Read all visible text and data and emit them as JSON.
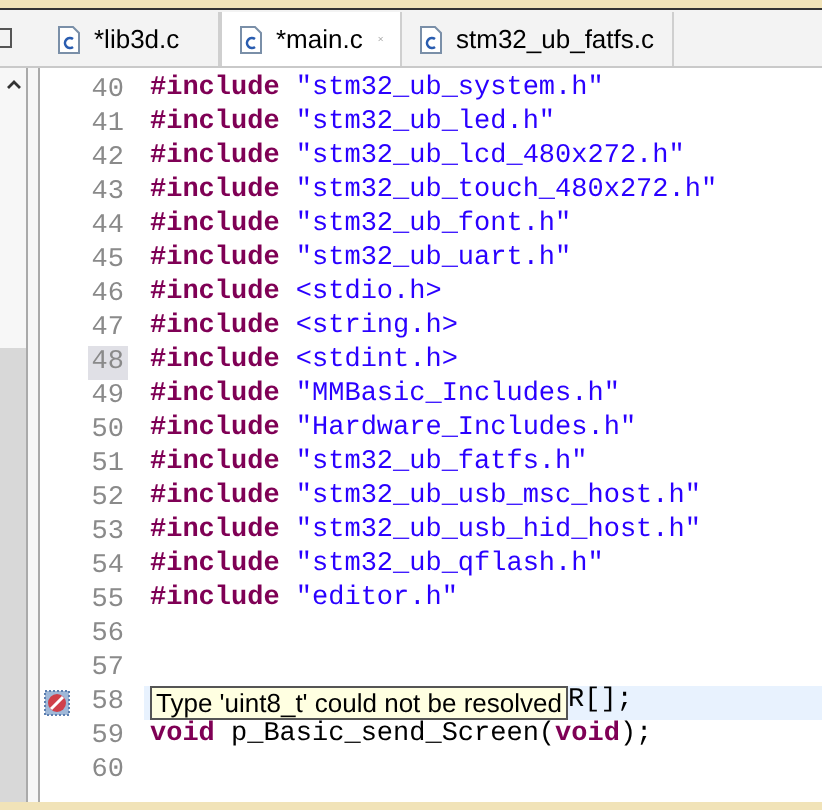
{
  "tabs": [
    {
      "label": "*lib3d.c",
      "selected": false
    },
    {
      "label": "*main.c",
      "selected": true
    },
    {
      "label": "stm32_ub_fatfs.c",
      "selected": false
    }
  ],
  "lines": [
    {
      "number": "40",
      "highlighted": false,
      "selected": false,
      "segments": [
        {
          "kind": "directive",
          "text": "#include"
        },
        {
          "kind": "string",
          "text": " \"stm32_ub_system.h\""
        }
      ]
    },
    {
      "number": "41",
      "highlighted": false,
      "selected": false,
      "segments": [
        {
          "kind": "directive",
          "text": "#include"
        },
        {
          "kind": "string",
          "text": " \"stm32_ub_led.h\""
        }
      ]
    },
    {
      "number": "42",
      "highlighted": false,
      "selected": false,
      "segments": [
        {
          "kind": "directive",
          "text": "#include"
        },
        {
          "kind": "string",
          "text": " \"stm32_ub_lcd_480x272.h\""
        }
      ]
    },
    {
      "number": "43",
      "highlighted": false,
      "selected": false,
      "segments": [
        {
          "kind": "directive",
          "text": "#include"
        },
        {
          "kind": "string",
          "text": " \"stm32_ub_touch_480x272.h\""
        }
      ]
    },
    {
      "number": "44",
      "highlighted": false,
      "selected": false,
      "segments": [
        {
          "kind": "directive",
          "text": "#include"
        },
        {
          "kind": "string",
          "text": " \"stm32_ub_font.h\""
        }
      ]
    },
    {
      "number": "45",
      "highlighted": false,
      "selected": false,
      "segments": [
        {
          "kind": "directive",
          "text": "#include"
        },
        {
          "kind": "string",
          "text": " \"stm32_ub_uart.h\""
        }
      ]
    },
    {
      "number": "46",
      "highlighted": false,
      "selected": false,
      "segments": [
        {
          "kind": "directive",
          "text": "#include"
        },
        {
          "kind": "string",
          "text": " <stdio.h>"
        }
      ]
    },
    {
      "number": "47",
      "highlighted": false,
      "selected": false,
      "segments": [
        {
          "kind": "directive",
          "text": "#include"
        },
        {
          "kind": "string",
          "text": " <string.h>"
        }
      ]
    },
    {
      "number": "48",
      "highlighted": true,
      "selected": false,
      "segments": [
        {
          "kind": "directive",
          "text": "#include"
        },
        {
          "kind": "string",
          "text": " <stdint.h>"
        }
      ]
    },
    {
      "number": "49",
      "highlighted": false,
      "selected": false,
      "segments": [
        {
          "kind": "directive",
          "text": "#include"
        },
        {
          "kind": "string",
          "text": " \"MMBasic_Includes.h\""
        }
      ]
    },
    {
      "number": "50",
      "highlighted": false,
      "selected": false,
      "segments": [
        {
          "kind": "directive",
          "text": "#include"
        },
        {
          "kind": "string",
          "text": " \"Hardware_Includes.h\""
        }
      ]
    },
    {
      "number": "51",
      "highlighted": false,
      "selected": false,
      "segments": [
        {
          "kind": "directive",
          "text": "#include"
        },
        {
          "kind": "string",
          "text": " \"stm32_ub_fatfs.h\""
        }
      ]
    },
    {
      "number": "52",
      "highlighted": false,
      "selected": false,
      "segments": [
        {
          "kind": "directive",
          "text": "#include"
        },
        {
          "kind": "string",
          "text": " \"stm32_ub_usb_msc_host.h\""
        }
      ]
    },
    {
      "number": "53",
      "highlighted": false,
      "selected": false,
      "segments": [
        {
          "kind": "directive",
          "text": "#include"
        },
        {
          "kind": "string",
          "text": " \"stm32_ub_usb_hid_host.h\""
        }
      ]
    },
    {
      "number": "54",
      "highlighted": false,
      "selected": false,
      "segments": [
        {
          "kind": "directive",
          "text": "#include"
        },
        {
          "kind": "string",
          "text": " \"stm32_ub_qflash.h\""
        }
      ]
    },
    {
      "number": "55",
      "highlighted": false,
      "selected": false,
      "segments": [
        {
          "kind": "directive",
          "text": "#include"
        },
        {
          "kind": "string",
          "text": " \"editor.h\""
        }
      ]
    },
    {
      "number": "56",
      "highlighted": false,
      "selected": false
    },
    {
      "number": "57",
      "highlighted": false,
      "selected": false
    },
    {
      "number": "58",
      "highlighted": false,
      "selected": true,
      "error": true,
      "tooltip": "Type 'uint8_t' could not be resolved",
      "segments": [
        {
          "kind": "plain",
          "text": "R[];"
        }
      ]
    },
    {
      "number": "59",
      "highlighted": false,
      "selected": false,
      "segments": [
        {
          "kind": "keyword",
          "text": "void"
        },
        {
          "kind": "plain",
          "text": " p_Basic_send_Screen("
        },
        {
          "kind": "keyword",
          "text": "void"
        },
        {
          "kind": "plain",
          "text": ");"
        }
      ]
    },
    {
      "number": "60",
      "highlighted": false,
      "selected": false
    }
  ]
}
